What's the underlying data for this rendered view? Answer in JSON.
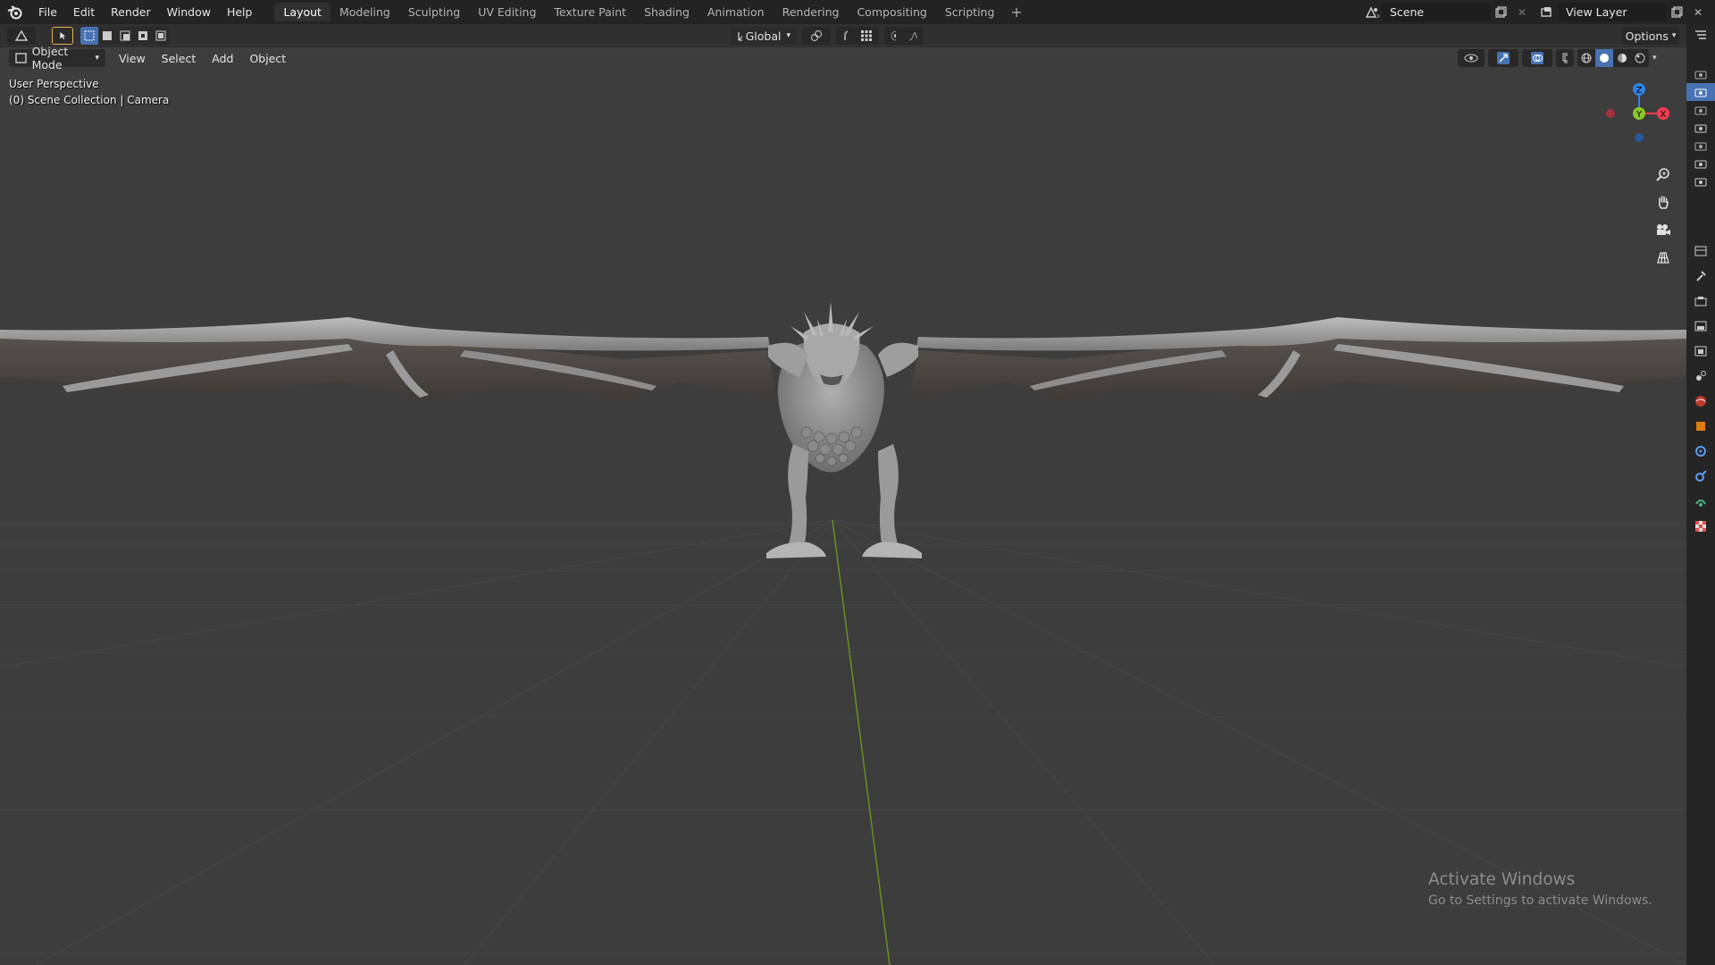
{
  "top_menu": {
    "items": [
      "File",
      "Edit",
      "Render",
      "Window",
      "Help"
    ]
  },
  "workspaces": {
    "tabs": [
      "Layout",
      "Modeling",
      "Sculpting",
      "UV Editing",
      "Texture Paint",
      "Shading",
      "Animation",
      "Rendering",
      "Compositing",
      "Scripting"
    ],
    "active": "Layout",
    "add_label": "+"
  },
  "scene": {
    "name": "Scene"
  },
  "view_layer": {
    "name": "View Layer"
  },
  "tool_header": {
    "transform_orientation": "Global",
    "options_label": "Options"
  },
  "view_header": {
    "mode": "Object Mode",
    "menus": [
      "View",
      "Select",
      "Add",
      "Object"
    ]
  },
  "viewport": {
    "perspective_label": "User Perspective",
    "collection_label": "(0) Scene Collection | Camera",
    "gizmo": {
      "x_label": "X",
      "y_label": "Y",
      "z_label": "Z"
    }
  },
  "watermark": {
    "title": "Activate Windows",
    "subtitle": "Go to Settings to activate Windows."
  },
  "colors": {
    "accent": "#4772b3",
    "axis_x": "#f63d52",
    "axis_y": "#8bc72a",
    "axis_z": "#2f84e3",
    "viewport_bg": "#3d3d3d"
  },
  "icons": [
    "blender-logo-icon",
    "select-cursor-icon",
    "zoom-icon",
    "hand-pan-icon",
    "camera-view-icon",
    "grid-ortho-icon",
    "scene-icon",
    "view-layer-icon"
  ]
}
